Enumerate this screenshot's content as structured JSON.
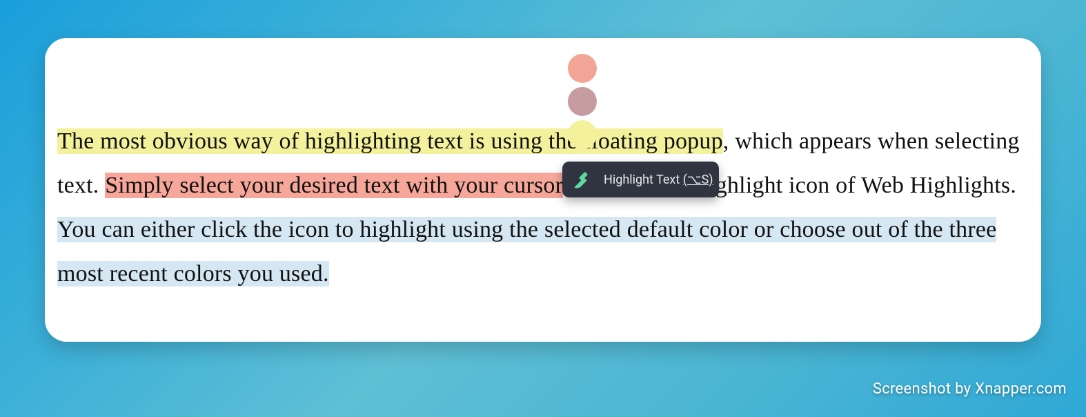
{
  "paragraph": {
    "seg1_yellow": "The most obvious way of highlighting text is using the floating popup",
    "seg2_plain": ", which appears when selecting text. ",
    "seg3_pink": "Simply select your desired text with your cursor",
    "seg4_plain": " and click the highlight icon of Web Highlights. ",
    "seg5_blue": "You can either click the icon to highlight using the selected default color or choose out of the three most recent colors you used."
  },
  "color_dots": {
    "dot1": "#f2a596",
    "dot2": "#c79ca1",
    "dot3": "#f3f19c"
  },
  "popup": {
    "label": "Highlight Text",
    "shortcut": "(⌥S)"
  },
  "watermark": "Screenshot by Xnapper.com"
}
